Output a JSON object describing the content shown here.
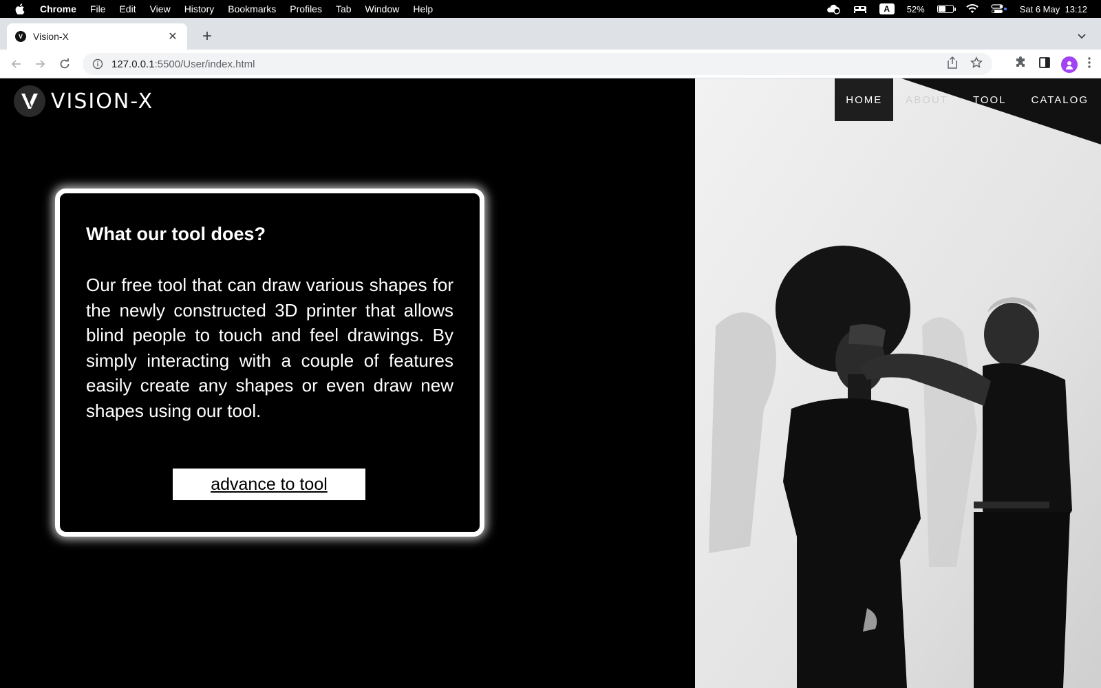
{
  "menubar": {
    "app_name": "Chrome",
    "items": [
      "File",
      "Edit",
      "View",
      "History",
      "Bookmarks",
      "Profiles",
      "Tab",
      "Window",
      "Help"
    ],
    "input_source": "A",
    "battery_percent": "52%",
    "battery_level": 0.52,
    "datetime": "Sat 6 May  13:12"
  },
  "browser": {
    "tab_title": "Vision-X",
    "url_host": "127.0.0.1",
    "url_rest": ":5500/User/index.html"
  },
  "site": {
    "logo_text": "VISION-X",
    "nav": [
      {
        "label": "HOME",
        "active": true
      },
      {
        "label": "ABOUT",
        "active": false
      },
      {
        "label": "TOOL",
        "active": false
      },
      {
        "label": "CATALOG",
        "active": false
      }
    ],
    "card": {
      "heading": "What our tool does?",
      "body": "Our free tool that can draw various shapes for the newly constructed 3D printer that allows blind people to touch and feel drawings. By simply interacting with a couple of features easily create any shapes or even draw new shapes using our tool.",
      "cta_label": "advance to tool"
    }
  }
}
